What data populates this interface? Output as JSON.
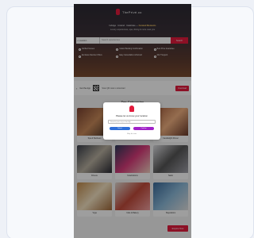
{
  "app": {
    "logo_text": "ThePrivé.co"
  },
  "hero": {
    "tagline_line1": "Indulge · Unwind · Celebrate —",
    "tagline_highlight": "Curated Moments",
    "tagline_line2": "Luxury experiences, spa, dining & more near you",
    "search": {
      "location": "Location",
      "placeholder": "Search experiences",
      "button": "Search"
    },
    "features": [
      "Verified Venues",
      "Instant Booking Confirmation",
      "Best Price Guarantee",
      "Exclusive Member Offers",
      "Easy Cancellation & Refund",
      "24x7 Support"
    ]
  },
  "app_strip": {
    "left_arrow": "‹",
    "text": "Get the App",
    "subtext": "Scan QR code to download",
    "button": "Download"
  },
  "categories": {
    "title": "Top Categories",
    "items": [
      {
        "label": "Spa & Wellness",
        "color": "c1"
      },
      {
        "label": "Fine Dining",
        "color": "c2"
      },
      {
        "label": "Candlelight Dinner",
        "color": "c3"
      },
      {
        "label": "Fitness",
        "color": "c4"
      },
      {
        "label": "Celebrations",
        "color": "c5"
      },
      {
        "label": "Salon",
        "color": "c6"
      },
      {
        "label": "Yoga",
        "color": "c7"
      },
      {
        "label": "Cafe & Bakery",
        "color": "c8"
      },
      {
        "label": "Staycations",
        "color": "c9"
      }
    ]
  },
  "fab": {
    "label": "Enquire Now"
  },
  "modal": {
    "title": "Please let us know your location",
    "input_placeholder": "Search your city or locality",
    "btn_detect": "Detect",
    "btn_confirm": "Confirm",
    "skip": "Skip for now"
  }
}
